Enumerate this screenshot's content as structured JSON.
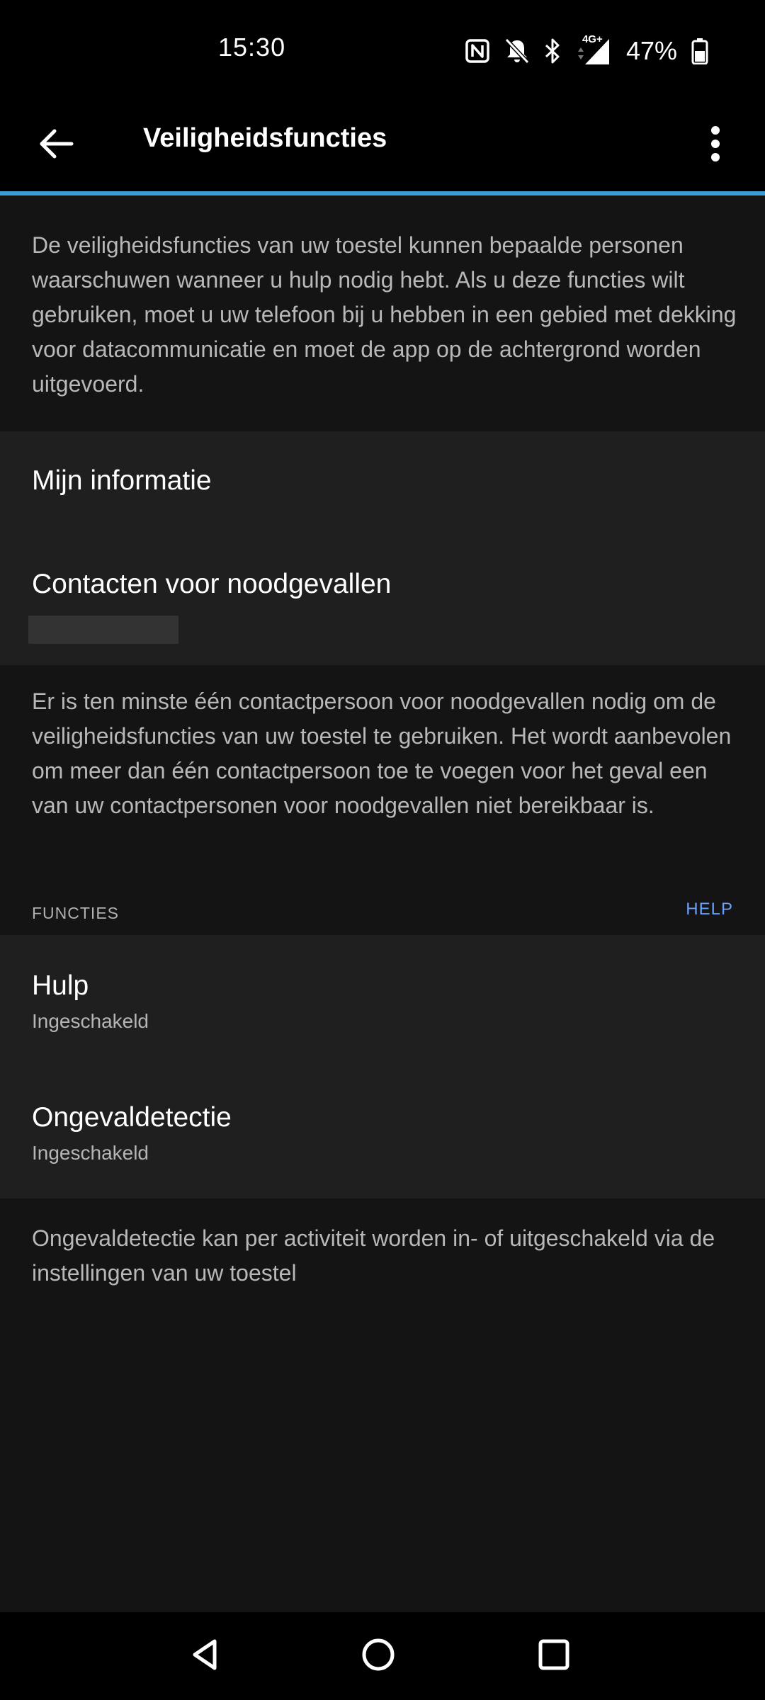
{
  "status_bar": {
    "time": "15:30",
    "network": "4G+",
    "battery_percent": "47%",
    "icons": [
      "nfc-icon",
      "bell-off-icon",
      "bluetooth-icon",
      "signal-icon",
      "battery-icon"
    ]
  },
  "app_bar": {
    "title": "Veiligheidsfuncties",
    "back_icon": "arrow-left-icon",
    "menu_icon": "more-vert-icon"
  },
  "intro_text": "De veiligheidsfuncties van uw toestel kunnen bepaalde personen waarschuwen wanneer u hulp nodig hebt. Als u deze functies wilt gebruiken, moet u uw telefoon bij u hebben in een gebied met dekking voor datacommunicatie en moet de app op de achtergrond worden uitgevoerd.",
  "settings": {
    "my_info": "Mijn informatie",
    "emergency_contacts": "Contacten voor noodgevallen"
  },
  "contacts_note": "Er is ten minste één contactpersoon voor noodgevallen nodig om de veiligheidsfuncties van uw toestel te gebruiken. Het wordt aanbevolen om meer dan één contactpersoon toe te voegen voor het geval een van uw contactpersonen voor noodgevallen niet bereikbaar is.",
  "functions": {
    "header": "FUNCTIES",
    "help_link": "HELP",
    "items": [
      {
        "title": "Hulp",
        "status": "Ingeschakeld"
      },
      {
        "title": "Ongevaldetectie",
        "status": "Ingeschakeld"
      }
    ]
  },
  "footer_note": "Ongevaldetectie kan per activiteit worden in- of uitgeschakeld via de instellingen van uw toestel",
  "nav_bar": {
    "icons": [
      "back-triangle-icon",
      "home-circle-icon",
      "recents-square-icon"
    ]
  },
  "colors": {
    "accent": "#3d9bd6",
    "link": "#6aa0ff",
    "background": "#141414",
    "card": "#1f1f1f"
  }
}
